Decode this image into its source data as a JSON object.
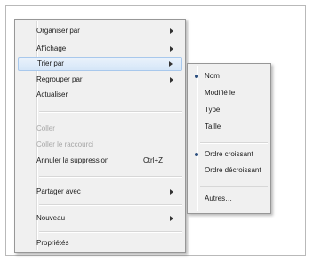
{
  "context_menu": {
    "items": [
      {
        "label": "Organiser par",
        "submenu": true
      },
      {
        "label": "Affichage",
        "submenu": true
      },
      {
        "label": "Trier par",
        "submenu": true,
        "highlighted": true
      },
      {
        "label": "Regrouper par",
        "submenu": true
      },
      {
        "label": "Actualiser"
      },
      {
        "label": "Coller",
        "disabled": true
      },
      {
        "label": "Coller le raccourci",
        "disabled": true
      },
      {
        "label": "Annuler la suppression",
        "shortcut": "Ctrl+Z"
      },
      {
        "label": "Partager avec",
        "submenu": true
      },
      {
        "label": "Nouveau",
        "submenu": true
      },
      {
        "label": "Propriétés"
      }
    ]
  },
  "sort_submenu": {
    "items": [
      {
        "label": "Nom",
        "checked": true
      },
      {
        "label": "Modifié le",
        "checked": false
      },
      {
        "label": "Type",
        "checked": false
      },
      {
        "label": "Taille",
        "checked": false
      },
      {
        "label": "Ordre croissant",
        "checked": true
      },
      {
        "label": "Ordre décroissant",
        "checked": false
      },
      {
        "label": "Autres…"
      }
    ]
  }
}
